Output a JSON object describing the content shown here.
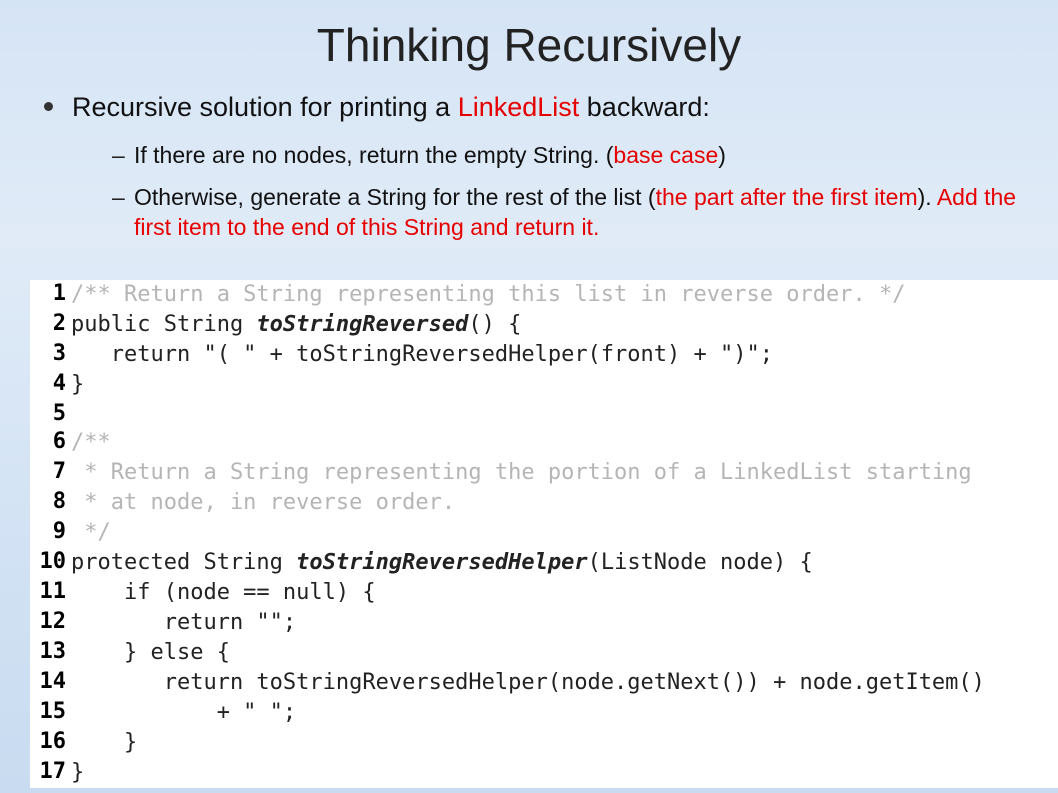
{
  "title": "Thinking Recursively",
  "bullet1_lead": "Recursive solution for printing a ",
  "bullet1_red": "LinkedList",
  "bullet1_tail": " backward:",
  "sub1_lead": "If there are no nodes, return the empty String. (",
  "sub1_red": "base case",
  "sub1_tail": ")",
  "sub2_lead": "Otherwise, generate a String for the rest of the list (",
  "sub2_red1": "the part after the first item",
  "sub2_mid": "). ",
  "sub2_red2": "Add the first item to the end of this String and return it.",
  "code": {
    "l1": "/** Return a String representing this list in reverse order. */",
    "l2a": "public String ",
    "l2b": "toStringReversed",
    "l2c": "() {",
    "l3": "   return \"( \" + toStringReversedHelper(front) + \")\";",
    "l4": "}",
    "l5": "",
    "l6": "/**",
    "l7": " * Return a String representing the portion of a LinkedList starting",
    "l8": " * at node, in reverse order.",
    "l9": " */",
    "l10a": "protected String ",
    "l10b": "toStringReversedHelper",
    "l10c": "(ListNode node) {",
    "l11": "    if (node == null) {",
    "l12": "       return \"\";",
    "l13": "    } else {",
    "l14": "       return toStringReversedHelper(node.getNext()) + node.getItem()",
    "l15": "           + \" \";",
    "l16": "    }",
    "l17": "}"
  }
}
